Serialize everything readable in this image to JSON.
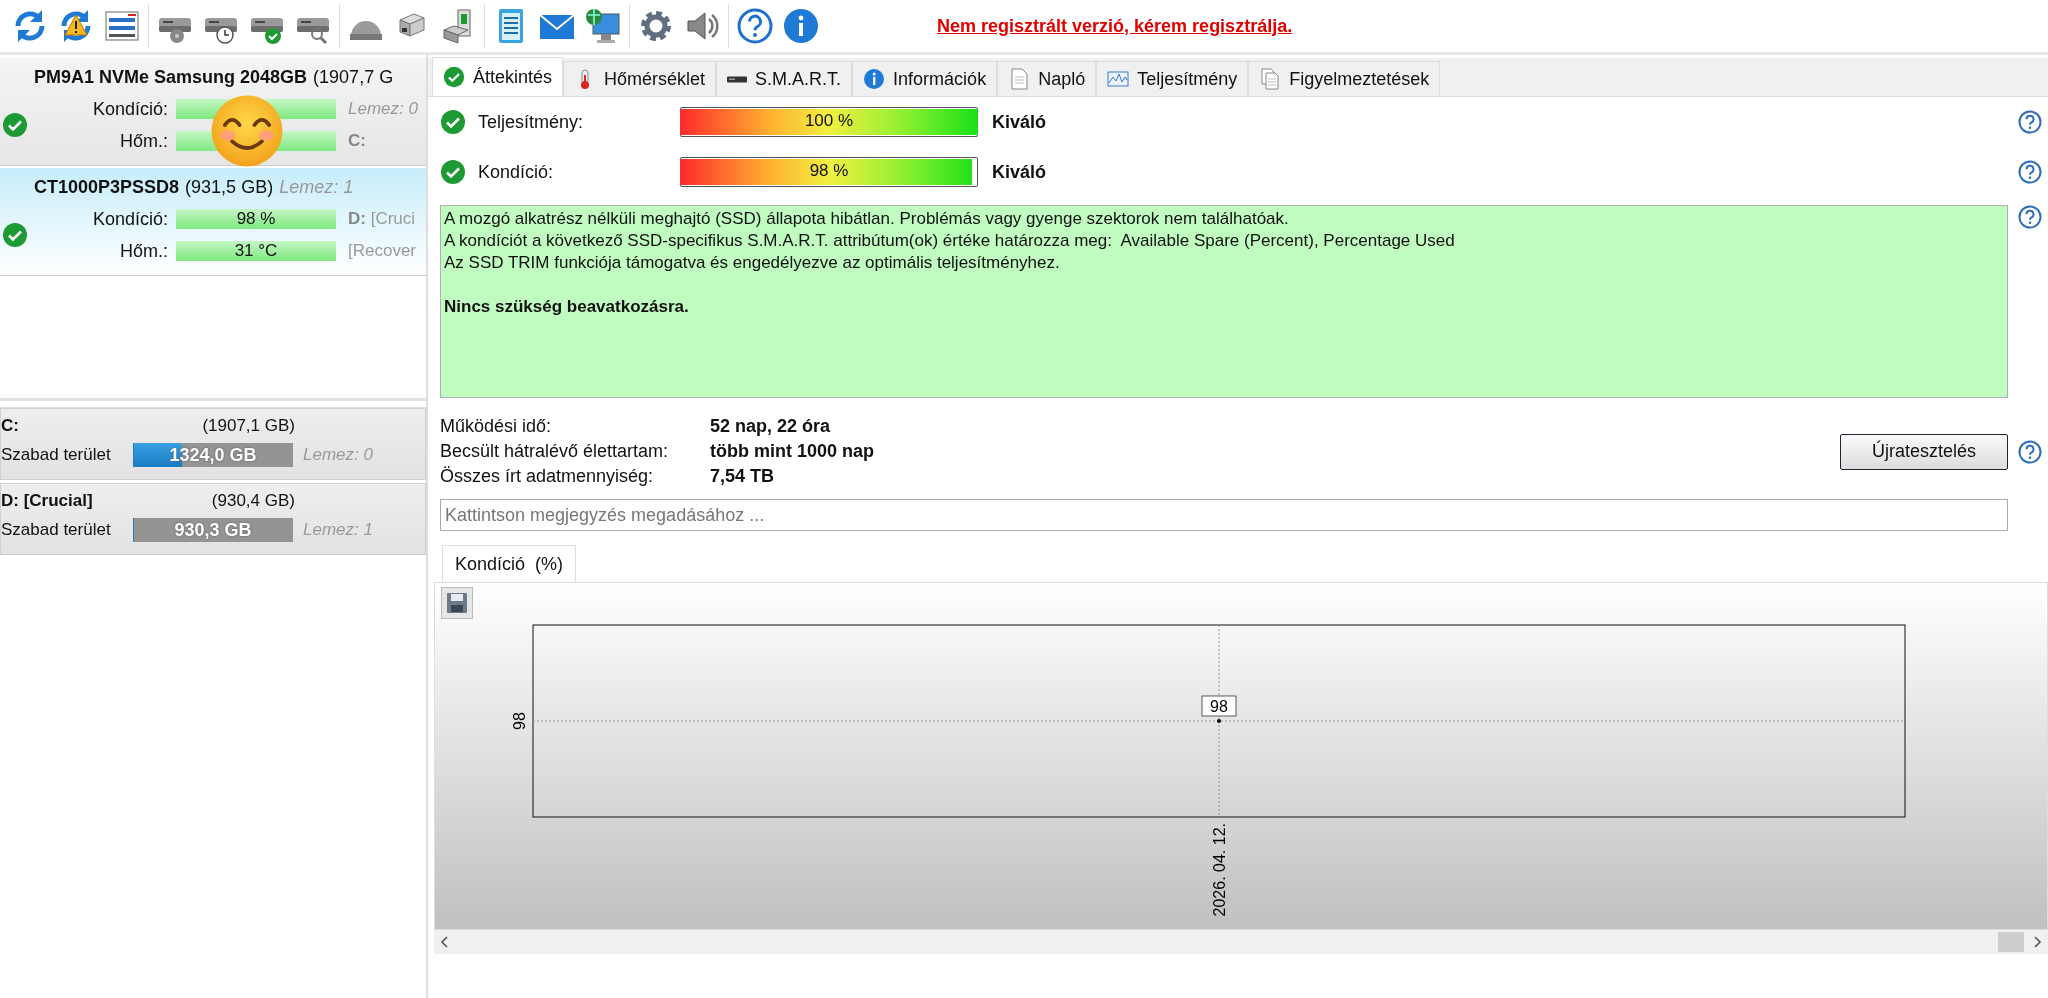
{
  "toolbar": {
    "notice": "Nem regisztrált verzió, kérem regisztrálja."
  },
  "drives": [
    {
      "name": "PM9A1 NVMe Samsung 2048GB",
      "size": "(1907,7 G",
      "selected": false,
      "ok": true,
      "rows": [
        {
          "label": "Kondíció:",
          "value": null,
          "side": "Lemez: 0",
          "side_italic": true
        },
        {
          "label": "Hőm.:",
          "value": null,
          "side": "**C:**",
          "side_italic": false
        }
      ]
    },
    {
      "name": "CT1000P3PSSD8",
      "size": "(931,5 GB)",
      "disk": "Lemez: 1",
      "selected": true,
      "ok": true,
      "rows": [
        {
          "label": "Kondíció:",
          "value": "98 %",
          "side": "**D:** [Cruci",
          "side_italic": false
        },
        {
          "label": "Hőm.:",
          "value": "31 °C",
          "side": "[Recover",
          "side_italic": false
        }
      ]
    }
  ],
  "volumes": [
    {
      "name": "C:",
      "size": "(1907,1 GB)",
      "free_label": "Szabad terület",
      "free": "1324,0 GB",
      "level": 0.3,
      "disk": "Lemez: 0"
    },
    {
      "name": "D: [Crucial]",
      "size": "(930,4 GB)",
      "free_label": "Szabad terület",
      "free": "930,3 GB",
      "level": 0,
      "disk": "Lemez: 1"
    }
  ],
  "tabs": [
    {
      "label": "Áttekintés",
      "kind": "check",
      "selected": true
    },
    {
      "label": "Hőmérséklet",
      "kind": "thermometer",
      "selected": false
    },
    {
      "label": "S.M.A.R.T.",
      "kind": "drive",
      "selected": false
    },
    {
      "label": "Információk",
      "kind": "info",
      "selected": false
    },
    {
      "label": "Napló",
      "kind": "document",
      "selected": false
    },
    {
      "label": "Teljesítmény",
      "kind": "chart",
      "selected": false
    },
    {
      "label": "Figyelmeztetések",
      "kind": "documents",
      "selected": false
    }
  ],
  "metrics": [
    {
      "label": "Teljesítmény:",
      "ok": true,
      "value": "100 %",
      "level": 1,
      "rating": "Kiváló"
    },
    {
      "label": "Kondíció:",
      "ok": true,
      "value": "98 %",
      "level": 0.98,
      "rating": "Kiváló"
    }
  ],
  "summary": [
    {
      "bold": false,
      "lines": [
        "A mozgó alkatrész nélküli meghajtó (SSD) állapota hibátlan. Problémás vagy gyenge szektorok nem találhatóak.",
        "A kondíciót a következő SSD-specifikus S.M.A.R.T. attribútum(ok) értéke határozza meg:  Available Spare (Percent), Percentage Used",
        "Az SSD TRIM funkciója támogatva és engedélyezve az optimális teljesítményhez."
      ]
    },
    {
      "bold": true,
      "lines": [
        "Nincs szükség beavatkozásra."
      ]
    }
  ],
  "stats": [
    {
      "label": "Működési idő:",
      "value": "52 nap, 22 óra"
    },
    {
      "label": "Becsült hátralévő élettartam:",
      "value": "több mint 1000 nap"
    },
    {
      "label": "Összes írt adatmennyiség:",
      "value": "7,54 TB"
    }
  ],
  "retest_button": "Újratesztelés",
  "note": {
    "placeholder": "Kattintson megjegyzés megadásához ..."
  },
  "chart_tab": "Kondíció  (%)",
  "chart": {
    "y_tick": "98",
    "x_tick": "2026. 04. 12.",
    "point_label": "98"
  }
}
